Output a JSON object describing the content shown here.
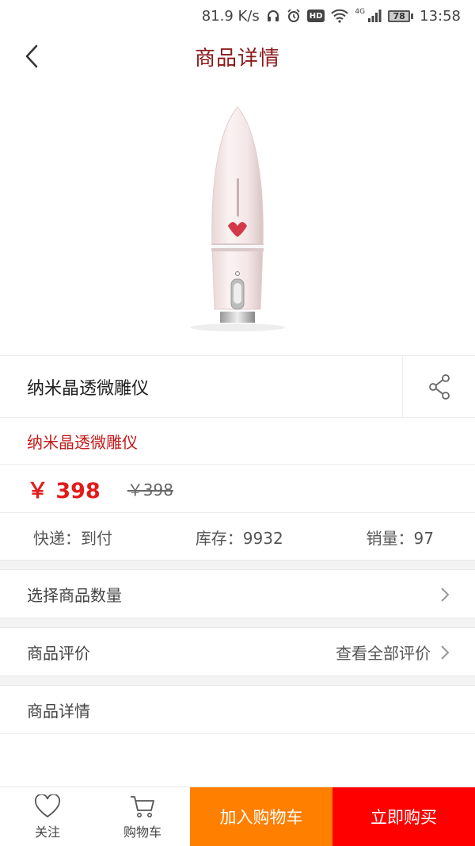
{
  "status_bar": {
    "speed": "81.9 K/s",
    "hd_label": "HD",
    "network": "4G",
    "battery": "78",
    "time": "13:58"
  },
  "header": {
    "title": "商品详情",
    "back_icon": "chevron-left-icon"
  },
  "product": {
    "name": "纳米晶透微雕仪",
    "subtitle": "纳米晶透微雕仪",
    "price": "￥ 398",
    "original_price": "￥398",
    "shipping": "快递：到付",
    "stock": "库存：9932",
    "sales": "销量：97"
  },
  "rows": {
    "quantity_label": "选择商品数量",
    "review_label": "商品评价",
    "review_link": "查看全部评价",
    "detail_label": "商品详情"
  },
  "bottom_bar": {
    "follow_label": "关注",
    "cart_label": "购物车",
    "add_cart_label": "加入购物车",
    "buy_label": "立即购买"
  },
  "colors": {
    "title_red": "#8b1a1a",
    "price_red": "#e31b1b",
    "orange": "#ff7f00",
    "buy_red": "#fe0000"
  }
}
